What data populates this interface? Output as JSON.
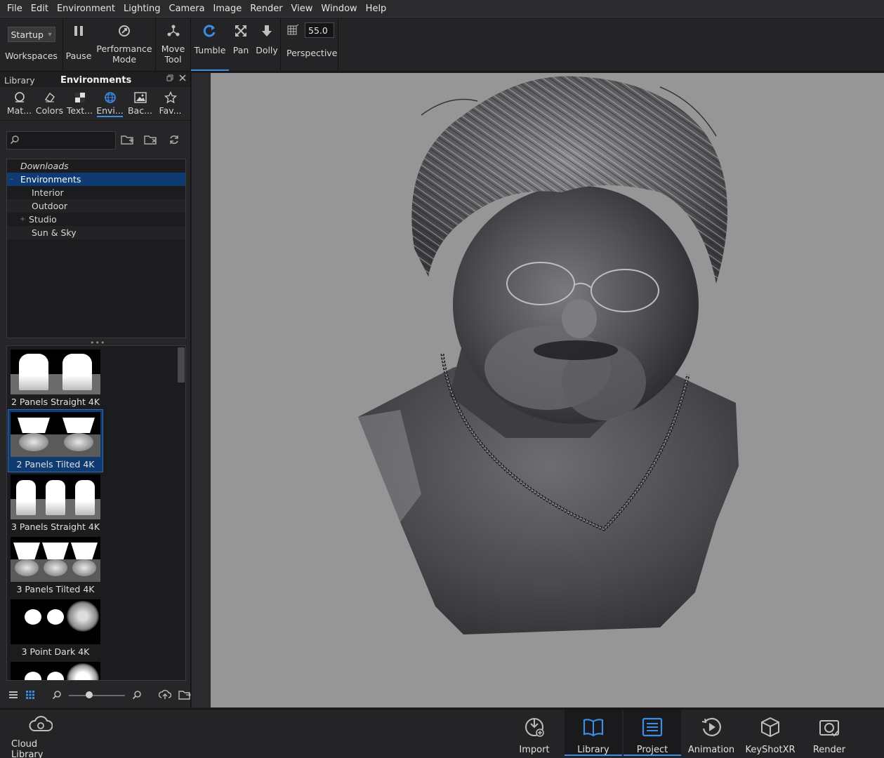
{
  "menu": [
    "File",
    "Edit",
    "Environment",
    "Lighting",
    "Camera",
    "Image",
    "Render",
    "View",
    "Window",
    "Help"
  ],
  "toolbar": {
    "workspace_value": "Startup",
    "workspaces_label": "Workspaces",
    "pause_label": "Pause",
    "performance_label_1": "Performance",
    "performance_label_2": "Mode",
    "move_label_1": "Move",
    "move_label_2": "Tool",
    "tumble_label": "Tumble",
    "pan_label": "Pan",
    "dolly_label": "Dolly",
    "fov_value": "55.0",
    "perspective_label": "Perspective"
  },
  "library": {
    "header_left": "Library",
    "header_title": "Environments",
    "tabs": [
      "Mat...",
      "Colors",
      "Text...",
      "Envi...",
      "Bac...",
      "Fav..."
    ],
    "active_tab": "Envi...",
    "tree": [
      {
        "label": "Downloads",
        "level": 0,
        "italic": true
      },
      {
        "label": "Environments",
        "level": 0,
        "selected": true
      },
      {
        "label": "Interior",
        "level": 1
      },
      {
        "label": "Outdoor",
        "level": 1
      },
      {
        "label": "Studio",
        "level": 1,
        "expandable": true
      },
      {
        "label": "Sun & Sky",
        "level": 1
      }
    ],
    "thumbnails": [
      "2 Panels Straight 4K",
      "2 Panels Tilted 4K",
      "3 Panels Straight 4K",
      "3 Panels Tilted 4K",
      "3 Point Dark 4K"
    ],
    "selected_thumbnail": "2 Panels Tilted 4K"
  },
  "bottom": {
    "cloud_library": "Cloud Library",
    "import": "Import",
    "library": "Library",
    "project": "Project",
    "animation": "Animation",
    "keyshotxr": "KeyShotXR",
    "render": "Render"
  },
  "colors": {
    "accent": "#3b8de8",
    "selection": "#0e3c72",
    "viewport_bg": "#969696"
  }
}
